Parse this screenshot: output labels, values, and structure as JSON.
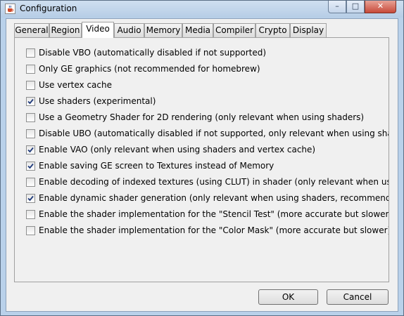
{
  "window": {
    "title": "Configuration",
    "minimize_glyph": "–",
    "maximize_glyph": "□",
    "close_glyph": "✕",
    "app_icon": "java-cup-icon"
  },
  "tabs": [
    {
      "label": "General",
      "active": false
    },
    {
      "label": "Region",
      "active": false
    },
    {
      "label": "Video",
      "active": true
    },
    {
      "label": "Audio",
      "active": false
    },
    {
      "label": "Memory",
      "active": false
    },
    {
      "label": "Media",
      "active": false
    },
    {
      "label": "Compiler",
      "active": false
    },
    {
      "label": "Crypto",
      "active": false
    },
    {
      "label": "Display",
      "active": false
    }
  ],
  "options": [
    {
      "label": "Disable VBO (automatically disabled if not supported)",
      "checked": false
    },
    {
      "label": "Only GE graphics (not recommended for homebrew)",
      "checked": false
    },
    {
      "label": "Use vertex cache",
      "checked": false
    },
    {
      "label": "Use shaders (experimental)",
      "checked": true
    },
    {
      "label": "Use a Geometry Shader for 2D rendering (only relevant when using shaders)",
      "checked": false
    },
    {
      "label": "Disable UBO (automatically disabled if not supported, only relevant when using shaders",
      "checked": false
    },
    {
      "label": "Enable VAO (only relevant when using shaders and vertex cache)",
      "checked": true
    },
    {
      "label": "Enable saving GE screen to Textures instead of Memory",
      "checked": true
    },
    {
      "label": "Enable decoding of indexed textures (using CLUT) in shader (only relevant when using",
      "checked": false
    },
    {
      "label": "Enable dynamic shader generation (only relevant when using shaders, recommended f",
      "checked": true
    },
    {
      "label": "Enable the shader implementation for the \"Stencil Test\" (more accurate but slower)",
      "checked": false
    },
    {
      "label": "Enable the shader implementation for the \"Color Mask\" (more accurate but slower)",
      "checked": false
    }
  ],
  "buttons": {
    "ok": "OK",
    "cancel": "Cancel"
  },
  "colors": {
    "checkmark": "#1f3a7a",
    "frame": "#b9d1ea",
    "close_button": "#c74a3a"
  }
}
